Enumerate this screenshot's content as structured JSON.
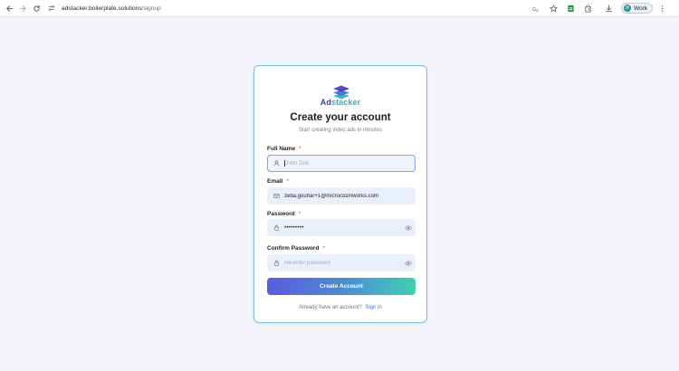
{
  "browser": {
    "url_host": "adstacker.boilerplate.solutions",
    "url_path": "/signup",
    "profile_label": "Work",
    "profile_initial": "W"
  },
  "brand": {
    "name_part1": "Ad",
    "name_part2": "stacker",
    "accent_color": "#3f3a9c",
    "accent_color2": "#2cb3a8"
  },
  "signup": {
    "title": "Create your account",
    "subtitle": "Start creating video ads in minutes",
    "full_name": {
      "label": "Full Name",
      "required_mark": "*",
      "value": "",
      "placeholder": "John Doe"
    },
    "email": {
      "label": "Email",
      "required_mark": "*",
      "value": "zeba.gouhar+1@microcosmworks.com",
      "placeholder": ""
    },
    "password": {
      "label": "Password",
      "required_mark": "*",
      "masked_value": "•••••••••"
    },
    "confirm_password": {
      "label": "Confirm Password",
      "required_mark": "*",
      "value": "",
      "placeholder": "Re-enter password"
    },
    "submit_label": "Create Account",
    "footer_text": "Already have an account?",
    "signin_link": "Sign in"
  }
}
